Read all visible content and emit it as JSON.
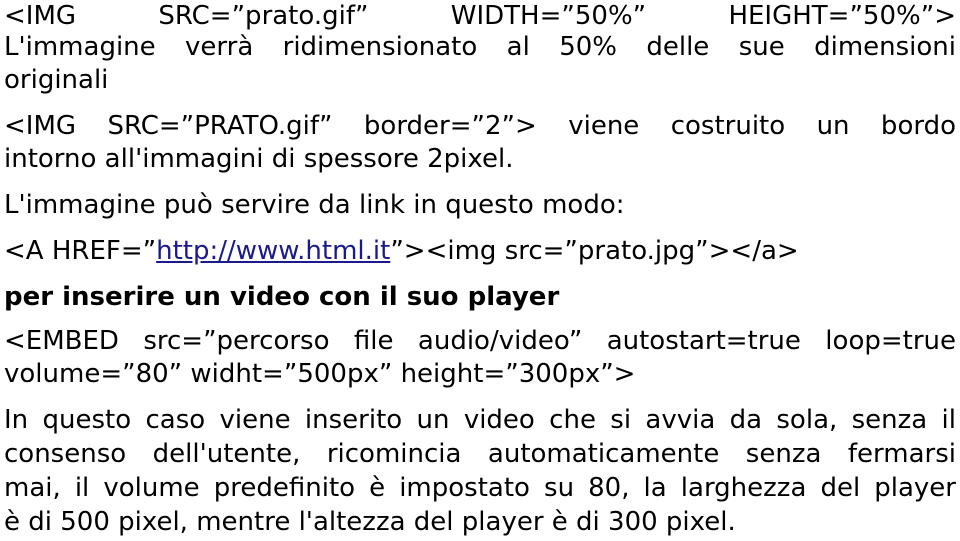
{
  "paragraphs": {
    "img_size_code": {
      "parts": [
        "<IMG",
        "SRC=”prato.gif”",
        "WIDTH=”50%”",
        "HEIGHT=”50%”>"
      ]
    },
    "img_size_desc": {
      "line1": "L'immagine verrà ridimensionato al 50% delle sue dimensioni",
      "line2": "originali"
    },
    "img_border_code": {
      "line1": "<IMG SRC=”PRATO.gif” border=”2”> viene costruito un bordo",
      "line2": "intorno all'immagini di spessore 2pixel."
    },
    "img_link_intro": "L'immagine può servire da link in questo modo:",
    "img_link_code": {
      "before": "<A HREF=”",
      "link": "http://www.html.it",
      "after": "”><img src=”prato.jpg”></a>"
    },
    "video_heading": "per inserire un video con il suo player",
    "embed_code": {
      "line1": "<EMBED src=”percorso file audio/video” autostart=true loop=true",
      "line2": "volume=”80” widht=”500px” height=”300px”>"
    },
    "embed_desc": {
      "line1": "In questo caso viene inserito un video che si avvia da sola, senza il",
      "line2": "consenso dell'utente, ricomincia automaticamente senza fermarsi",
      "line3": "mai, il volume predefinito è impostato su 80, la larghezza del player",
      "line4": "è di 500 pixel, mentre l'altezza del player è di 300 pixel."
    }
  },
  "colors": {
    "text": "#000000",
    "link": "#1a1a8c",
    "background": "#ffffff"
  }
}
